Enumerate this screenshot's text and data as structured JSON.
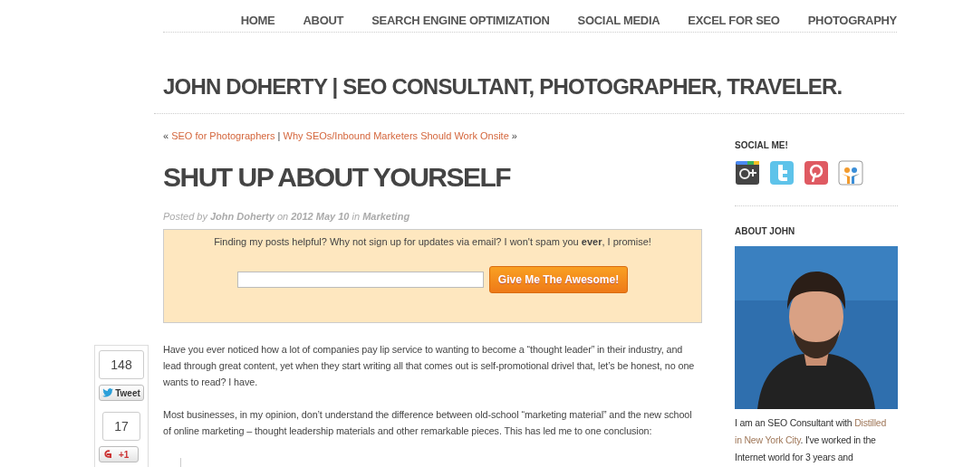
{
  "nav": [
    {
      "label": "HOME"
    },
    {
      "label": "ABOUT"
    },
    {
      "label": "SEARCH ENGINE OPTIMIZATION"
    },
    {
      "label": "SOCIAL MEDIA"
    },
    {
      "label": "EXCEL FOR SEO"
    },
    {
      "label": "PHOTOGRAPHY"
    }
  ],
  "site_title": "JOHN DOHERTY | SEO CONSULTANT, PHOTOGRAPHER, TRAVELER.",
  "post_nav": {
    "prev_mark": "«",
    "prev": "SEO for Photographers",
    "separator": "|",
    "next": "Why SEOs/Inbound Marketers Should Work Onsite",
    "next_mark": "»"
  },
  "post_title": "SHUT UP ABOUT YOURSELF",
  "meta": "Posted by **John Doherty** on **2012 May 10** in **Marketing**",
  "subscribe": {
    "text": "Finding my posts helpful? Why not sign up for updates via email? I won't spam you **ever**, I promise!",
    "button": "Give Me The Awesome!"
  },
  "share": [
    {
      "kind": "twitter",
      "count": "148",
      "button": "Tweet"
    },
    {
      "kind": "gplus",
      "count": "17",
      "button": "+1"
    }
  ],
  "paragraphs": [
    "Have you ever noticed how a lot of companies pay lip service to wanting to become a “thought leader” in their industry, and lead through great content, yet when they start writing all that comes out is self-promotional drivel that, let’s be honest, no one wants to read? I have.",
    "Most businesses, in my opinion, don’t understand the difference between old-school “marketing material” and the new school of online marketing – thought leadership materials and other remarkable pieces. This has led me to one conclusion:"
  ],
  "sidebar": {
    "social_heading": "SOCIAL ME!",
    "social": [
      {
        "kind": "gplus"
      },
      {
        "kind": "twitter"
      },
      {
        "kind": "pinterest"
      },
      {
        "kind": "slideshare"
      }
    ],
    "about_heading": "ABOUT JOHN",
    "about_before": "I am an SEO Consultant with",
    "about_link": [
      "Distilled",
      "in New York City"
    ],
    "about_after": ". I've worked in the Internet world for 3 years and"
  }
}
